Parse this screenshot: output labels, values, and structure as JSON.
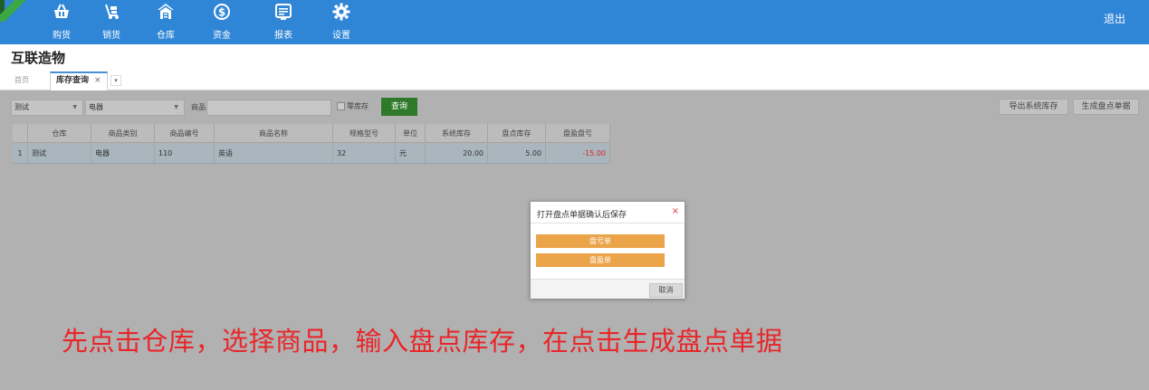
{
  "nav": {
    "items": [
      {
        "label": "购货",
        "icon": "basket-icon"
      },
      {
        "label": "销货",
        "icon": "hand-truck-icon"
      },
      {
        "label": "仓库",
        "icon": "warehouse-icon"
      },
      {
        "label": "资金",
        "icon": "dollar-icon"
      },
      {
        "label": "报表",
        "icon": "report-icon"
      },
      {
        "label": "设置",
        "icon": "gear-icon"
      }
    ],
    "logout": "退出"
  },
  "app_title": "互联造物",
  "tabs": {
    "home": "首页",
    "active": "库存查询",
    "close_glyph": "×",
    "more_glyph": "▾"
  },
  "toolbar": {
    "warehouse_value": "测试",
    "category_value": "电器",
    "goods_label": "商品:",
    "goods_value": "",
    "zero_stock_label": "零库存",
    "query": "查询",
    "export": "导出系统库存",
    "generate": "生成盘点单据"
  },
  "table": {
    "headers": [
      "仓库",
      "商品类别",
      "商品编号",
      "商品名称",
      "规格型号",
      "单位",
      "系统库存",
      "盘点库存",
      "盘盈盘亏"
    ],
    "rows": [
      {
        "index": "1",
        "cells": [
          "测试",
          "电器",
          "110",
          "英语",
          "32",
          "元",
          "20.00",
          "5.00",
          "-15.00"
        ]
      }
    ]
  },
  "dialog": {
    "title": "打开盘点单据确认后保存",
    "close": "×",
    "options": [
      "盘亏单",
      "盘盈单"
    ],
    "cancel": "取消"
  },
  "annotation": "先点击仓库，选择商品，输入盘点库存，在点击生成盘点单据",
  "colors": {
    "topbar": "#2f85d6",
    "query_button": "#2f7a2a",
    "dialog_option": "#eba44a",
    "negative": "#d22222",
    "annotation": "#e8262a"
  }
}
